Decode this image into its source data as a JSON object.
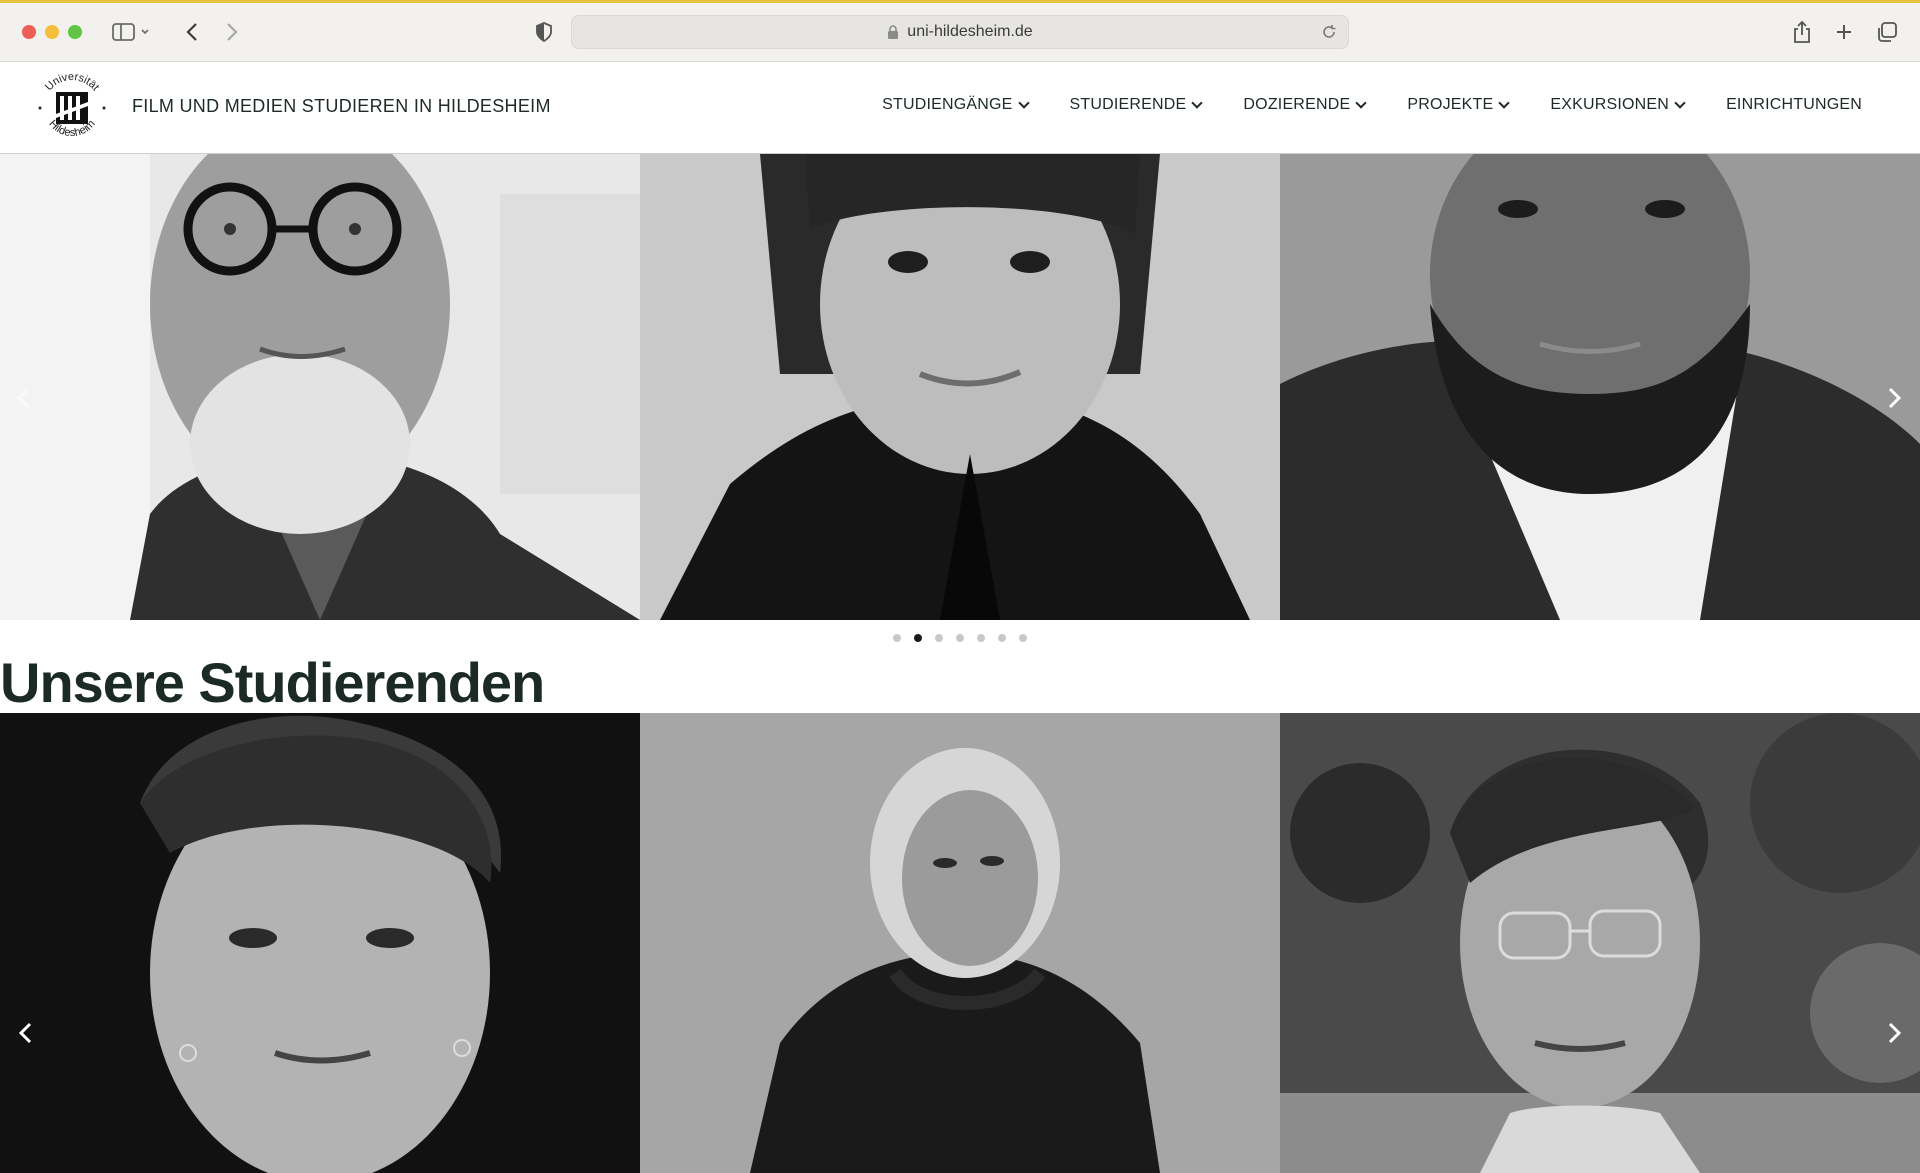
{
  "browser": {
    "url": "uni-hildesheim.de"
  },
  "site": {
    "logo_text_top": "Universität",
    "logo_text_bottom": "Hildesheim",
    "title": "FILM UND MEDIEN STUDIEREN IN HILDESHEIM"
  },
  "nav": {
    "items": [
      {
        "label": "STUDIENGÄNGE",
        "has_dropdown": true
      },
      {
        "label": "STUDIERENDE",
        "has_dropdown": true
      },
      {
        "label": "DOZIERENDE",
        "has_dropdown": true
      },
      {
        "label": "PROJEKTE",
        "has_dropdown": true
      },
      {
        "label": "EXKURSIONEN",
        "has_dropdown": true
      },
      {
        "label": "EINRICHTUNGEN",
        "has_dropdown": false
      }
    ]
  },
  "lecturers_carousel": {
    "slides": [
      "portrait-older-man-glasses-beard",
      "portrait-woman-bangs",
      "portrait-man-beard-suit"
    ],
    "indicator_count": 7,
    "active_indicator": 2
  },
  "students_section": {
    "heading": "Unsere Studierenden",
    "slides": [
      "portrait-young-man-earrings",
      "portrait-young-woman-hoodie",
      "portrait-young-man-glasses"
    ]
  },
  "icons": {
    "sidebar": "sidebar-icon",
    "back": "chevron-left-icon",
    "forward": "chevron-right-icon",
    "privacy": "shield-icon",
    "lock": "lock-icon",
    "reload": "reload-icon",
    "share": "share-icon",
    "new_tab": "plus-icon",
    "tabs": "tab-overview-icon"
  },
  "colors": {
    "heading": "#1b2a24",
    "nav_text": "#1e2a25",
    "close": "#ee5e58",
    "minimize": "#f5bd3b",
    "maximize": "#5ec546"
  }
}
